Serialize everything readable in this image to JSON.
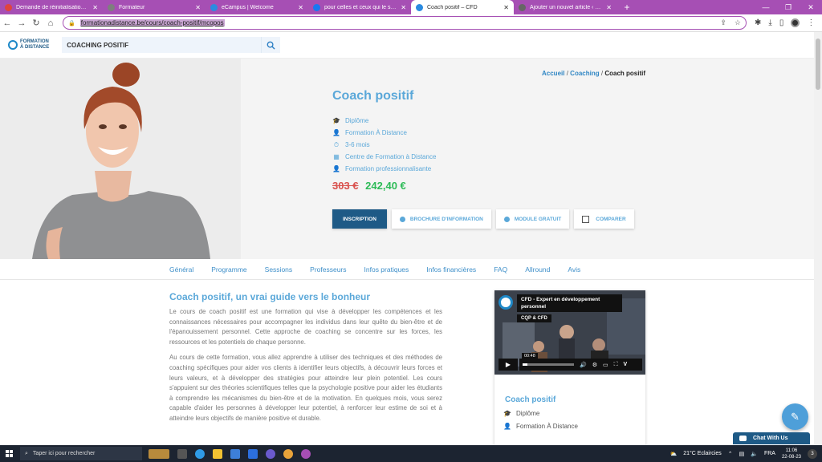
{
  "browser": {
    "tabs": [
      {
        "title": "Demande de réinitialisation de",
        "color": "#e0443e",
        "active": false
      },
      {
        "title": "Formateur",
        "color": "#7e7e7e",
        "active": false
      },
      {
        "title": "eCampus | Welcome",
        "color": "#2b8be0",
        "active": false
      },
      {
        "title": "pour celles et ceux qui le souhait",
        "color": "#1877f2",
        "active": false
      },
      {
        "title": "Coach positif – CFD",
        "color": "#2b8be0",
        "active": true
      },
      {
        "title": "Ajouter un nouvel article ‹ Melle",
        "color": "#666666",
        "active": false
      }
    ],
    "url": "formationadistance.be/cours/coach-positif/mcopos"
  },
  "site": {
    "logo_line1": "FORMATION",
    "logo_line2": "À DISTANCE",
    "search_value": "COACHING POSITIF"
  },
  "breadcrumb": {
    "home": "Accueil",
    "sep": "/",
    "parent": "Coaching",
    "current": "Coach positif"
  },
  "course": {
    "title": "Coach positif",
    "meta": [
      {
        "icon": "graduation-cap-icon",
        "glyph": "🎓",
        "text": "Diplôme"
      },
      {
        "icon": "user-icon",
        "glyph": "👤",
        "text": "Formation À Distance"
      },
      {
        "icon": "clock-icon",
        "glyph": "⏱",
        "text": "3-6 mois"
      },
      {
        "icon": "building-icon",
        "glyph": "▦",
        "text": "Centre de Formation à Distance"
      },
      {
        "icon": "person-icon",
        "glyph": "👤",
        "text": "Formation professionnalisante"
      }
    ],
    "price_old": "303 €",
    "price_new": "242,40 €",
    "buttons": {
      "inscription": "INSCRIPTION",
      "brochure": "BROCHURE D'INFORMATION",
      "module": "MODULE GRATUIT",
      "compare": "COMPARER"
    }
  },
  "course_tabs": [
    "Général",
    "Programme",
    "Sessions",
    "Professeurs",
    "Infos pratiques",
    "Infos financières",
    "FAQ",
    "Allround",
    "Avis"
  ],
  "content": {
    "heading": "Coach positif, un vrai guide vers le bonheur",
    "p1": "Le cours de coach positif est une formation qui vise à développer les compétences et les connaissances nécessaires pour accompagner les individus dans leur quête du bien-être et de l'épanouissement personnel. Cette approche de coaching se concentre sur les forces, les ressources et les potentiels de chaque personne.",
    "p2": "Au cours de cette formation, vous allez apprendre à utiliser des techniques et des méthodes de coaching spécifiques pour aider vos clients à identifier leurs objectifs, à découvrir leurs forces et leurs valeurs, et à développer des stratégies pour atteindre leur plein potentiel. Les cours s'appuient sur des théories scientifiques telles que la psychologie positive pour aider les étudiants à comprendre les mécanismes du bien-être et de la motivation. En quelques mois, vous serez capable d'aider les personnes à développer leur potentiel, à renforcer leur estime de soi et à atteindre leurs objectifs de manière positive et durable."
  },
  "video": {
    "title": "CFD - Expert en développement personnel",
    "badge": "CQP & CFD",
    "time": "00:48"
  },
  "card": {
    "title": "Coach positif",
    "item1": "Diplôme",
    "item2": "Formation À Distance"
  },
  "chat": {
    "label": "Chat With Us"
  },
  "taskbar": {
    "search_placeholder": "Taper ici pour rechercher",
    "weather": "21°C  Eclaircies",
    "lang": "FRA",
    "time": "11:06",
    "date": "22-08-23",
    "notif_count": "3"
  }
}
